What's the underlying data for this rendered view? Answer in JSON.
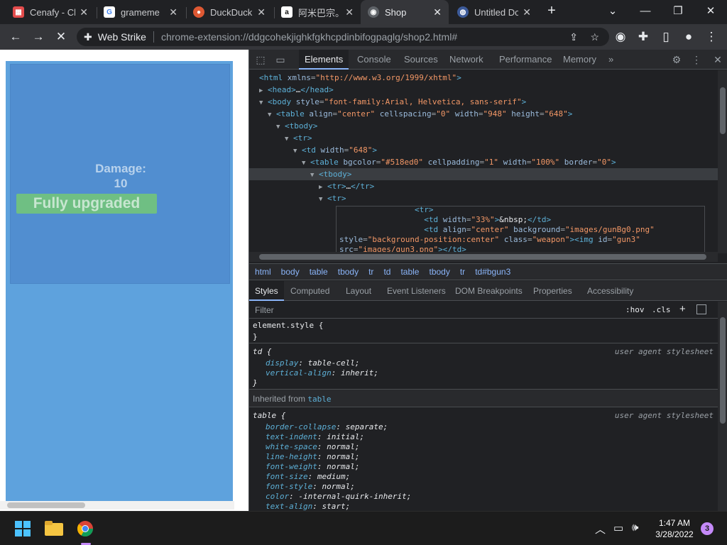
{
  "browser": {
    "tabs": [
      {
        "title": "Cenafy - Ch",
        "icon": "cenafy-favicon"
      },
      {
        "title": "grameme",
        "icon": "google-favicon"
      },
      {
        "title": "DuckDuck",
        "icon": "duckduckgo-favicon"
      },
      {
        "title": "阿米巴宗。",
        "icon": "amazon-favicon"
      },
      {
        "title": "Shop",
        "icon": "extension-favicon",
        "active": true
      },
      {
        "title": "Untitled Do",
        "icon": "globe-favicon"
      }
    ],
    "new_tab_label": "+",
    "omnibox": {
      "chip": "Web Strike",
      "url": "chrome-extension://ddgcohekjighkfgkhcpdinbifogpaglg/shop2.html#"
    }
  },
  "page": {
    "damage_label": "Damage:",
    "damage_value": "10",
    "upgrade_status": "Fully upgraded"
  },
  "devtools": {
    "tabs": [
      "Elements",
      "Console",
      "Sources",
      "Network",
      "Performance",
      "Memory"
    ],
    "more_tabs": "»",
    "dom_lines": [
      {
        "indent": 0,
        "arrow": "",
        "html": "<span class='tag'>&lt;html</span> <span class='att'>xmlns</span>=<span class='val'>\"http://www.w3.org/1999/xhtml\"</span><span class='tag'>&gt;</span>"
      },
      {
        "indent": 1,
        "arrow": "▶",
        "html": "<span class='tag'>&lt;head&gt;</span><span class='txt'>…</span><span class='tag'>&lt;/head&gt;</span>"
      },
      {
        "indent": 1,
        "arrow": "▼",
        "html": "<span class='tag'>&lt;body</span> <span class='att'>style</span>=<span class='val'>\"font-family:Arial, Helvetica, sans-serif\"</span><span class='tag'>&gt;</span>"
      },
      {
        "indent": 2,
        "arrow": "▼",
        "html": "<span class='tag'>&lt;table</span> <span class='att'>align</span>=<span class='val'>\"center\"</span> <span class='att'>cellspacing</span>=<span class='val'>\"0\"</span> <span class='att'>width</span>=<span class='val'>\"948\"</span> <span class='att'>height</span>=<span class='val'>\"648\"</span><span class='tag'>&gt;</span>"
      },
      {
        "indent": 3,
        "arrow": "▼",
        "html": "<span class='tag'>&lt;tbody&gt;</span>"
      },
      {
        "indent": 4,
        "arrow": "▼",
        "html": "<span class='tag'>&lt;tr&gt;</span>"
      },
      {
        "indent": 5,
        "arrow": "▼",
        "html": "<span class='tag'>&lt;td</span> <span class='att'>width</span>=<span class='val'>\"648\"</span><span class='tag'>&gt;</span>"
      },
      {
        "indent": 6,
        "arrow": "▼",
        "html": "<span class='tag'>&lt;table</span> <span class='att'>bgcolor</span>=<span class='val'>\"#518ed0\"</span> <span class='att'>cellpadding</span>=<span class='val'>\"1\"</span> <span class='att'>width</span>=<span class='val'>\"100%\"</span> <span class='att'>border</span>=<span class='val'>\"0\"</span><span class='tag'>&gt;</span>"
      },
      {
        "indent": 7,
        "arrow": "▼",
        "html": "<span class='tag'>&lt;tbody&gt;</span>",
        "highlight": true
      },
      {
        "indent": 8,
        "arrow": "▶",
        "html": "<span class='tag'>&lt;tr&gt;</span><span class='txt'>…</span><span class='tag'>&lt;/tr&gt;</span>"
      },
      {
        "indent": 8,
        "arrow": "▼",
        "html": "<span class='tag'>&lt;tr&gt;</span>"
      }
    ],
    "popup_lines": [
      {
        "html": "                <span class='tag'>&lt;tr&gt;</span>"
      },
      {
        "html": "                  <span class='tag'>&lt;td</span> <span class='att'>width</span>=<span class='val'>\"33%\"</span><span class='tag'>&gt;</span><span class='txt'>&amp;nbsp;</span><span class='tag'>&lt;/td&gt;</span>"
      },
      {
        "html": "                  <span class='tag'>&lt;td</span> <span class='att'>align</span>=<span class='val'>\"center\"</span> <span class='att'>background</span>=<span class='val'>\"images/gunBg0.png\"</span>"
      },
      {
        "html": "<span class='att'>style</span>=<span class='val'>\"background-position:center\"</span> <span class='att'>class</span>=<span class='val'>\"weapon\"</span><span class='tag'>&gt;&lt;img</span> <span class='att'>id</span>=<span class='val'>\"gun3\"</span>"
      },
      {
        "html": "<span class='att'>src</span>=<span class='val'>\"images/gun3.png\"</span><span class='tag'>&gt;&lt;/td&gt;</span>"
      }
    ],
    "breadcrumbs": [
      "html",
      "body",
      "table",
      "tbody",
      "tr",
      "td",
      "table",
      "tbody",
      "tr",
      "td#bgun3"
    ],
    "style_tabs": [
      "Styles",
      "Computed",
      "Layout",
      "Event Listeners",
      "DOM Breakpoints",
      "Properties",
      "Accessibility"
    ],
    "filter_placeholder": "Filter",
    "hov_label": ":hov",
    "cls_label": ".cls",
    "element_style": {
      "open": "element.style {",
      "close": "}"
    },
    "td_rule": {
      "selector": "td {",
      "source": "user agent stylesheet",
      "props": [
        {
          "name": "display",
          "value": "table-cell;"
        },
        {
          "name": "vertical-align",
          "value": "inherit;"
        }
      ],
      "close": "}"
    },
    "inherited_label": "Inherited from",
    "inherited_tag": "table",
    "table_rule": {
      "selector": "table {",
      "source": "user agent stylesheet",
      "props": [
        {
          "name": "border-collapse",
          "value": "separate;"
        },
        {
          "name": "text-indent",
          "value": "initial;"
        },
        {
          "name": "white-space",
          "value": "normal;"
        },
        {
          "name": "line-height",
          "value": "normal;"
        },
        {
          "name": "font-weight",
          "value": "normal;"
        },
        {
          "name": "font-size",
          "value": "medium;"
        },
        {
          "name": "font-style",
          "value": "normal;"
        },
        {
          "name": "color",
          "value": "-internal-quirk-inherit;"
        },
        {
          "name": "text-align",
          "value": "start;"
        }
      ]
    }
  },
  "taskbar": {
    "time": "1:47 AM",
    "date": "3/28/2022",
    "notifications": "3"
  },
  "colors": {
    "page_bg": "#5ea2dd",
    "card_bg": "#518ed0",
    "upgrade_bg": "#6fbf83",
    "devtools_bg": "#202124",
    "accent": "#8ab4f8"
  }
}
